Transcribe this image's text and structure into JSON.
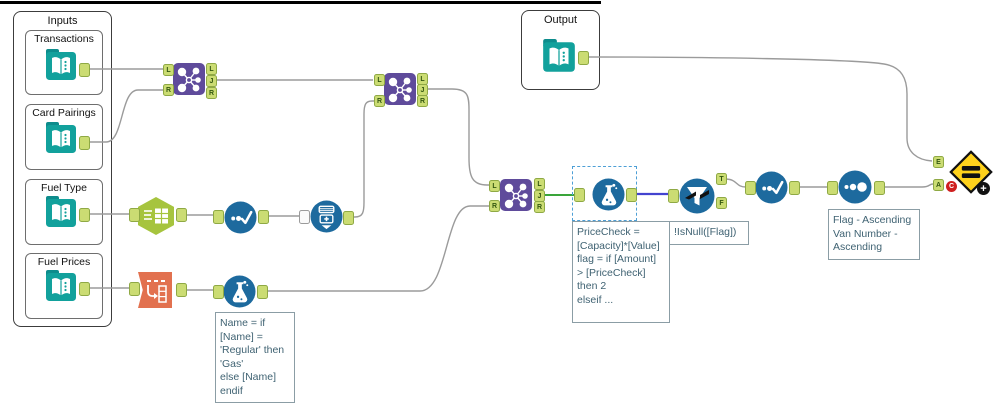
{
  "containers": {
    "inputs": {
      "label": "Inputs",
      "tools": [
        {
          "label": "Transactions"
        },
        {
          "label": "Card Pairings"
        },
        {
          "label": "Fuel Type"
        },
        {
          "label": "Fuel Prices"
        }
      ]
    },
    "output": {
      "label": "Output"
    }
  },
  "anchors": {
    "l": "L",
    "j": "J",
    "r": "R",
    "t": "T",
    "f": "F",
    "e": "E",
    "a": "A"
  },
  "badges": {
    "c": "C",
    "plus": "+"
  },
  "annotations": {
    "formula_name": "Name = if\n[Name] =\n'Regular' then\n'Gas'\nelse [Name]\nendif",
    "formula_pricecheck": "PriceCheck =\n[Capacity]*[Value]\nflag = if [Amount]\n> [PriceCheck]\nthen 2\nelseif ...",
    "filter": "!IsNull([Flag])",
    "sort": "Flag - Ascending\nVan Number -\nAscending"
  },
  "icons": {
    "input-data": "teal-open-book",
    "output-data": "teal-open-book",
    "join": "purple-molecule",
    "text-to-columns": "green-hexagon-text-grid",
    "unique": "dots-checkmark",
    "union": "stacked-tables-plus-arrow",
    "transpose": "orange-row-to-column",
    "formula": "flask",
    "filter": "funnel",
    "sort": "growing-dots",
    "compare": "yellow-diamond-equals"
  },
  "colors": {
    "teal": "#12a19c",
    "purple": "#5f4b9b",
    "blue": "#1d6a9e",
    "hex_green": "#a6c43e",
    "orange": "#e2714f",
    "anchor_green": "#cbdc73",
    "wire": "#9b9b9b",
    "wire_selected": "#4343cf",
    "wire_join_output": "#3aa53a",
    "diamond_yellow": "#ffd21c"
  }
}
